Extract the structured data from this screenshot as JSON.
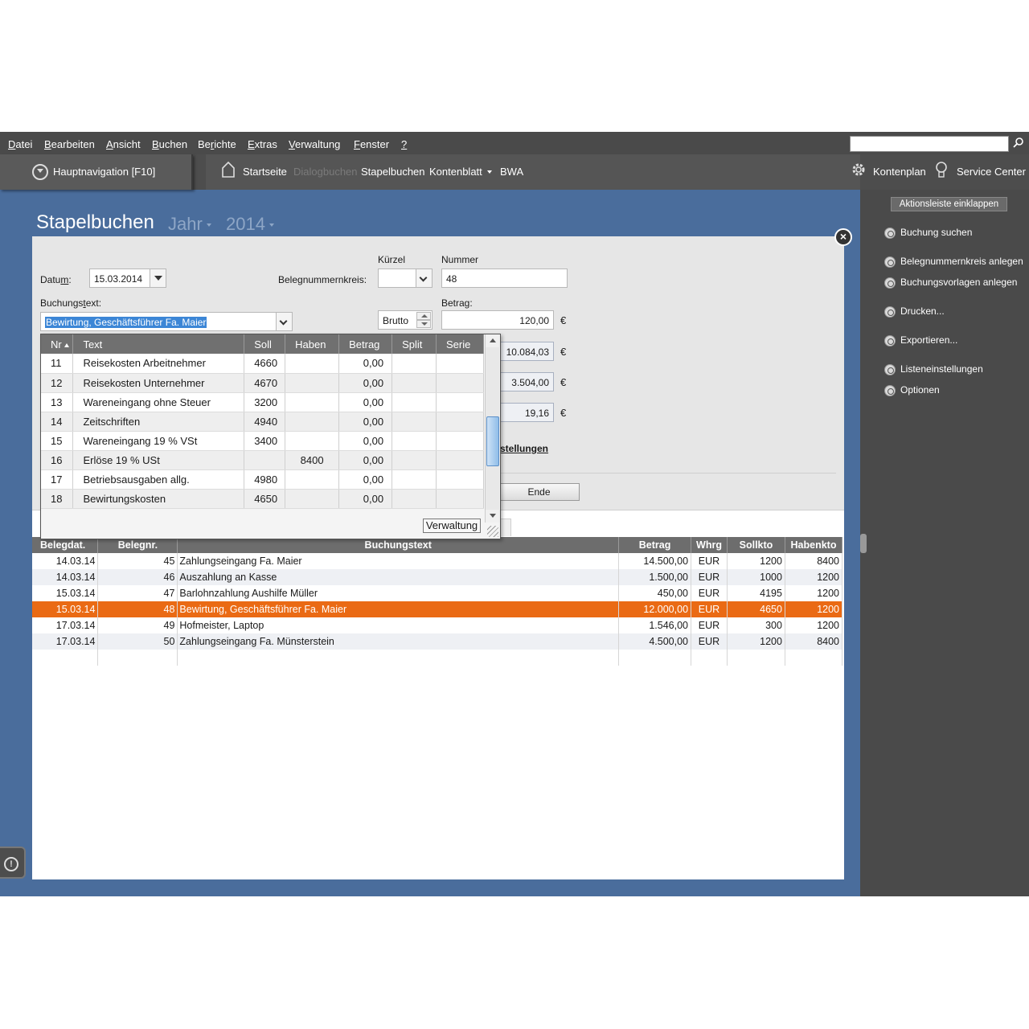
{
  "menu": {
    "items": [
      {
        "pre": "",
        "u": "D",
        "post": "atei"
      },
      {
        "pre": "",
        "u": "B",
        "post": "earbeiten"
      },
      {
        "pre": "",
        "u": "A",
        "post": "nsicht"
      },
      {
        "pre": "",
        "u": "B",
        "post": "uchen"
      },
      {
        "pre": "Be",
        "u": "r",
        "post": "ichte"
      },
      {
        "pre": "",
        "u": "E",
        "post": "xtras"
      },
      {
        "pre": "",
        "u": "V",
        "post": "erwaltung"
      },
      {
        "pre": "",
        "u": "F",
        "post": "enster"
      },
      {
        "pre": "",
        "u": "?",
        "post": ""
      }
    ]
  },
  "nav": {
    "haupt": "Hauptnavigation [F10]",
    "startseite": "Startseite",
    "dialogbuchen": "Dialogbuchen",
    "stapelbuchen": "Stapelbuchen",
    "kontenblatt": "Kontenblatt",
    "bwa": "BWA",
    "kontenplan": "Kontenplan",
    "service": "Service Center"
  },
  "page": {
    "title": "Stapelbuchen",
    "jahr": "Jahr",
    "year": "2014"
  },
  "form": {
    "datum_pre": "Datu",
    "datum_u": "m",
    "datum_post": ":",
    "datum_value": "15.03.2014",
    "kuerzel_label": "Kürzel",
    "beleg_label": "Belegnummernkreis:",
    "nummer_label": "Nummer",
    "nummer_value": "48",
    "buchungstext_pre": "Buchungs",
    "buchungstext_u": "t",
    "buchungstext_post": "ext:",
    "buchungstext_value": "Bewirtung, Geschäftsführer Fa. Maier",
    "brutto": "Brutto",
    "betrag_label": "Betrag:",
    "betrag_value": "120,00",
    "val2": "10.084,03",
    "val3": "3.504,00",
    "val4": "19,16",
    "euro": "€",
    "einstellungen_link": "stellungen",
    "ende": "Ende"
  },
  "popup": {
    "headers": {
      "nr": "Nr",
      "text": "Text",
      "soll": "Soll",
      "haben": "Haben",
      "betrag": "Betrag",
      "split": "Split",
      "serie": "Serie"
    },
    "rows": [
      {
        "nr": "11",
        "text": "Reisekosten Arbeitnehmer",
        "soll": "4660",
        "haben": "",
        "betrag": "0,00"
      },
      {
        "nr": "12",
        "text": "Reisekosten Unternehmer",
        "soll": "4670",
        "haben": "",
        "betrag": "0,00"
      },
      {
        "nr": "13",
        "text": "Wareneingang ohne Steuer",
        "soll": "3200",
        "haben": "",
        "betrag": "0,00"
      },
      {
        "nr": "14",
        "text": "Zeitschriften",
        "soll": "4940",
        "haben": "",
        "betrag": "0,00"
      },
      {
        "nr": "15",
        "text": "Wareneingang 19 % VSt",
        "soll": "3400",
        "haben": "",
        "betrag": "0,00"
      },
      {
        "nr": "16",
        "text": "Erlöse 19 % USt",
        "soll": "",
        "haben": "8400",
        "betrag": "0,00"
      },
      {
        "nr": "17",
        "text": "Betriebsausgaben allg.",
        "soll": "4980",
        "haben": "",
        "betrag": "0,00"
      },
      {
        "nr": "18",
        "text": "Bewirtungskosten",
        "soll": "4650",
        "haben": "",
        "betrag": "0,00"
      }
    ],
    "verwaltung": "Verwaltung"
  },
  "bookings": {
    "headers": {
      "belegdat": "Belegdat.",
      "belegnr": "Belegnr.",
      "buchungstext": "Buchungstext",
      "betrag": "Betrag",
      "whrg": "Whrg",
      "sollkto": "Sollkto",
      "habenkto": "Habenkto"
    },
    "rows": [
      {
        "date": "14.03.14",
        "nr": "45",
        "text": "Zahlungseingang Fa. Maier",
        "betrag": "14.500,00",
        "whrg": "EUR",
        "soll": "1200",
        "haben": "8400"
      },
      {
        "date": "14.03.14",
        "nr": "46",
        "text": "Auszahlung an Kasse",
        "betrag": "1.500,00",
        "whrg": "EUR",
        "soll": "1000",
        "haben": "1200"
      },
      {
        "date": "15.03.14",
        "nr": "47",
        "text": "Barlohnzahlung Aushilfe Müller",
        "betrag": "450,00",
        "whrg": "EUR",
        "soll": "4195",
        "haben": "1200"
      },
      {
        "date": "15.03.14",
        "nr": "48",
        "text": "Bewirtung, Geschäftsführer Fa. Maier",
        "betrag": "12.000,00",
        "whrg": "EUR",
        "soll": "4650",
        "haben": "1200"
      },
      {
        "date": "17.03.14",
        "nr": "49",
        "text": "Hofmeister, Laptop",
        "betrag": "1.546,00",
        "whrg": "EUR",
        "soll": "300",
        "haben": "1200"
      },
      {
        "date": "17.03.14",
        "nr": "50",
        "text": "Zahlungseingang Fa. Münsterstein",
        "betrag": "4.500,00",
        "whrg": "EUR",
        "soll": "1200",
        "haben": "8400"
      }
    ],
    "selected_color": "#ea6a14"
  },
  "sidebar": {
    "collapse": "Aktionsleiste einklappen",
    "items": [
      {
        "label": "Buchung suchen",
        "icon": "search-icon"
      },
      {
        "label": "Belegnummernkreis anlegen",
        "icon": "new-document-icon"
      },
      {
        "label": "Buchungsvorlagen anlegen",
        "icon": "new-document-icon"
      },
      {
        "label": "Drucken...",
        "icon": "printer-icon"
      },
      {
        "label": "Exportieren...",
        "icon": "export-icon"
      },
      {
        "label": "Listeneinstellungen",
        "icon": "tools-icon"
      },
      {
        "label": "Optionen",
        "icon": "tools-icon"
      }
    ]
  }
}
